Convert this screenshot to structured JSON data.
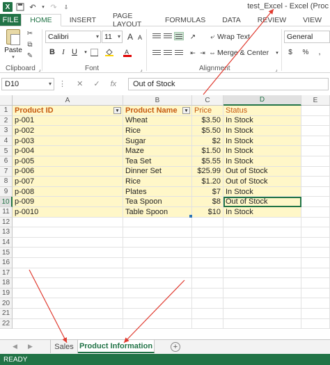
{
  "titlebar": {
    "window_title": "test_Excel - Excel (Proc",
    "logo_text": "X"
  },
  "ribbon": {
    "tabs": [
      "FILE",
      "HOME",
      "INSERT",
      "PAGE LAYOUT",
      "FORMULAS",
      "DATA",
      "REVIEW",
      "VIEW"
    ],
    "active_tab": "HOME",
    "clipboard": {
      "paste_label": "Paste",
      "group_label": "Clipboard"
    },
    "font": {
      "font_name": "Calibri",
      "font_size": "11",
      "group_label": "Font",
      "bold": "B",
      "italic": "I",
      "underline": "U",
      "grow": "A",
      "shrink": "A"
    },
    "alignment": {
      "wrap_text": "Wrap Text",
      "merge_center": "Merge & Center",
      "group_label": "Alignment"
    },
    "number": {
      "format": "General"
    }
  },
  "formula_bar": {
    "name_box": "D10",
    "fx": "fx",
    "formula": "Out of Stock"
  },
  "grid": {
    "columns": [
      "A",
      "B",
      "C",
      "D",
      "E"
    ],
    "selected_column": "D",
    "rows": [
      "1",
      "2",
      "3",
      "4",
      "5",
      "6",
      "7",
      "8",
      "9",
      "10",
      "11",
      "12",
      "13",
      "14",
      "15",
      "16",
      "17",
      "18",
      "19",
      "20",
      "21",
      "22"
    ],
    "selected_row": "10",
    "headers": [
      "Product ID",
      "Product Name",
      "Price",
      "Status"
    ],
    "data": [
      [
        "p-001",
        "Wheat",
        "$3.50",
        "In Stock"
      ],
      [
        "p-002",
        "Rice",
        "$5.50",
        "In Stock"
      ],
      [
        "p-003",
        "Sugar",
        "$2",
        "In Stock"
      ],
      [
        "p-004",
        "Maze",
        "$1.50",
        "In Stock"
      ],
      [
        "p-005",
        "Tea Set",
        "$5.55",
        "In Stock"
      ],
      [
        "p-006",
        "Dinner Set",
        "$25.99",
        "Out of Stock"
      ],
      [
        "p-007",
        "Rice",
        "$1.20",
        "Out of Stock"
      ],
      [
        "p-008",
        "Plates",
        "$7",
        "In Stock"
      ],
      [
        "p-009",
        "Tea Spoon",
        "$8",
        "Out of Stock"
      ],
      [
        "p-0010",
        "Table Spoon",
        "$10",
        "In Stock"
      ]
    ]
  },
  "sheets": {
    "tabs": [
      "Sales",
      "Product Information"
    ],
    "active": "Product Information",
    "add_label": "+"
  },
  "status": {
    "text": "READY"
  },
  "colors": {
    "accent": "#217346",
    "table_fill": "#fff7c8",
    "header_text": "#c55a11",
    "annotation_arrow": "#e03a2f"
  }
}
